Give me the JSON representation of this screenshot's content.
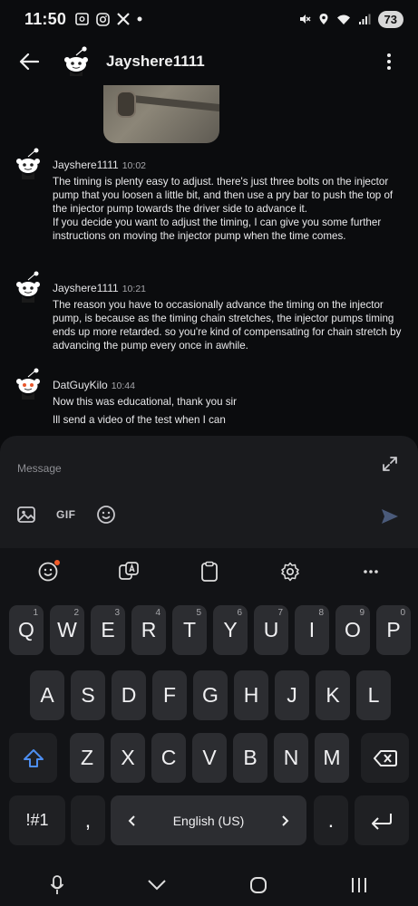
{
  "status_bar": {
    "time": "11:50",
    "battery": "73",
    "icons": [
      "screenshot-icon",
      "instagram-icon",
      "x-icon",
      "dot-icon",
      "mute-icon",
      "location-icon",
      "wifi-icon",
      "signal-icon"
    ]
  },
  "header": {
    "title": "Jayshere1111"
  },
  "messages": [
    {
      "author": "Jayshere1111",
      "time": "10:02",
      "lines": [
        "The timing is plenty easy to adjust. there's just three bolts on the injector pump that you loosen a little bit, and then use a pry bar to push the top of the injector pump towards the driver side to advance it.",
        "If you decide you want to adjust the timing, I can give you some further instructions on moving the injector pump when the time comes."
      ]
    },
    {
      "author": "Jayshere1111",
      "time": "10:21",
      "lines": [
        "The reason you have to occasionally advance the timing on the injector pump, is because as the timing chain stretches, the injector pumps timing ends up more retarded.  so you're kind of compensating for chain  stretch by advancing the pump every once in awhile."
      ]
    },
    {
      "author": "DatGuyKilo",
      "time": "10:44",
      "lines": [
        "Now this was educational, thank you sir",
        "Ill send a video of the test when I can"
      ]
    }
  ],
  "composer": {
    "placeholder": "Message",
    "gif_label": "GIF"
  },
  "keyboard": {
    "row1": [
      {
        "k": "Q",
        "h": "1"
      },
      {
        "k": "W",
        "h": "2"
      },
      {
        "k": "E",
        "h": "3"
      },
      {
        "k": "R",
        "h": "4"
      },
      {
        "k": "T",
        "h": "5"
      },
      {
        "k": "Y",
        "h": "6"
      },
      {
        "k": "U",
        "h": "7"
      },
      {
        "k": "I",
        "h": "8"
      },
      {
        "k": "O",
        "h": "9"
      },
      {
        "k": "P",
        "h": "0"
      }
    ],
    "row2": [
      "A",
      "S",
      "D",
      "F",
      "G",
      "H",
      "J",
      "K",
      "L"
    ],
    "row3": [
      "Z",
      "X",
      "C",
      "V",
      "B",
      "N",
      "M"
    ],
    "symbols_label": "!#1",
    "comma_label": ",",
    "period_label": ".",
    "language_label": "English (US)"
  }
}
